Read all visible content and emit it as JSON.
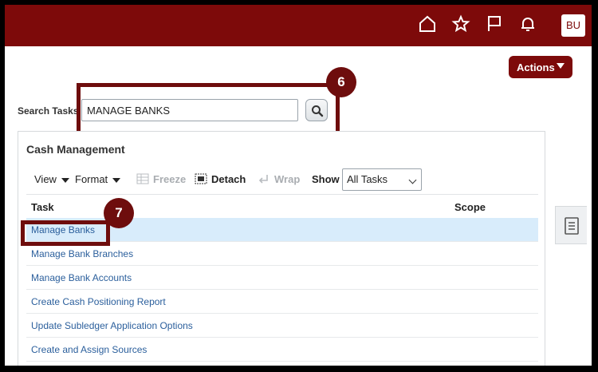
{
  "header": {
    "icons": [
      "home-icon",
      "favorites-star-icon",
      "flag-icon",
      "bell-icon"
    ],
    "user_initials": "BU"
  },
  "actions": {
    "label": "Actions"
  },
  "search": {
    "label": "Search Tasks",
    "value": "MANAGE BANKS"
  },
  "callouts": {
    "step_search": "6",
    "step_task": "7"
  },
  "panel": {
    "title": "Cash Management",
    "toolbar": {
      "view": "View",
      "format": "Format",
      "freeze": "Freeze",
      "detach": "Detach",
      "wrap": "Wrap",
      "show_label": "Show",
      "show_value": "All Tasks"
    },
    "columns": {
      "task": "Task",
      "scope": "Scope"
    },
    "rows": [
      "Manage Banks",
      "Manage Bank Branches",
      "Manage Bank Accounts",
      "Create Cash Positioning Report",
      "Update Subledger Application Options",
      "Create and Assign Sources"
    ]
  },
  "colors": {
    "brand": "#7d0a0a",
    "callout": "#6e0d0d",
    "link": "#2b5f9c",
    "selected_row": "#d8ecfb"
  }
}
